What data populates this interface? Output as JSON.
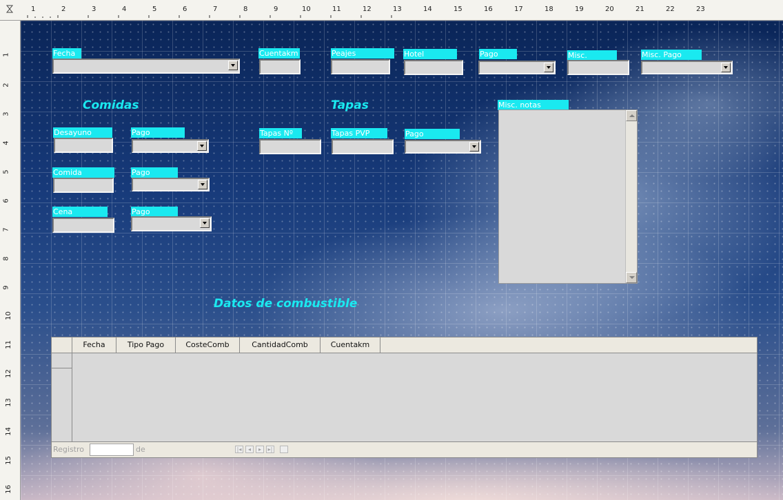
{
  "rulers": {
    "top": [
      "1",
      "2",
      "3",
      "4",
      "5",
      "6",
      "7",
      "8",
      "9",
      "10",
      "11",
      "12",
      "13",
      "14",
      "15",
      "16",
      "17",
      "18",
      "19",
      "20",
      "21",
      "22",
      "23"
    ],
    "left": [
      "1",
      "2",
      "3",
      "4",
      "5",
      "6",
      "7",
      "8",
      "9",
      "10",
      "11",
      "12",
      "13",
      "14",
      "15",
      "16"
    ]
  },
  "labels": {
    "fecha": "Fecha",
    "cuentakm": "Cuentakm",
    "peajes": "Peajes",
    "hotel": "Hotel",
    "pago": "Pago",
    "misc": "Misc.",
    "misc_pago": "Misc. Pago",
    "desayuno": "Desayuno",
    "comida": "Comida",
    "cena": "Cena",
    "tapas_n": "Tapas Nº",
    "tapas_pvp": "Tapas PVP",
    "misc_notas": "Misc. notas"
  },
  "sections": {
    "comidas": "Comidas",
    "tapas": "Tapas",
    "combustible": "Datos de combustible"
  },
  "table": {
    "columns": [
      "Fecha",
      "Tipo Pago",
      "CosteComb",
      "CantidadComb",
      "Cuentakm"
    ],
    "nav_registro": "Registro",
    "nav_de": "de"
  },
  "colors": {
    "label_bg": "#1ae9f0",
    "section_text": "#1ae9f0",
    "field_bg": "#d9d9d9"
  }
}
